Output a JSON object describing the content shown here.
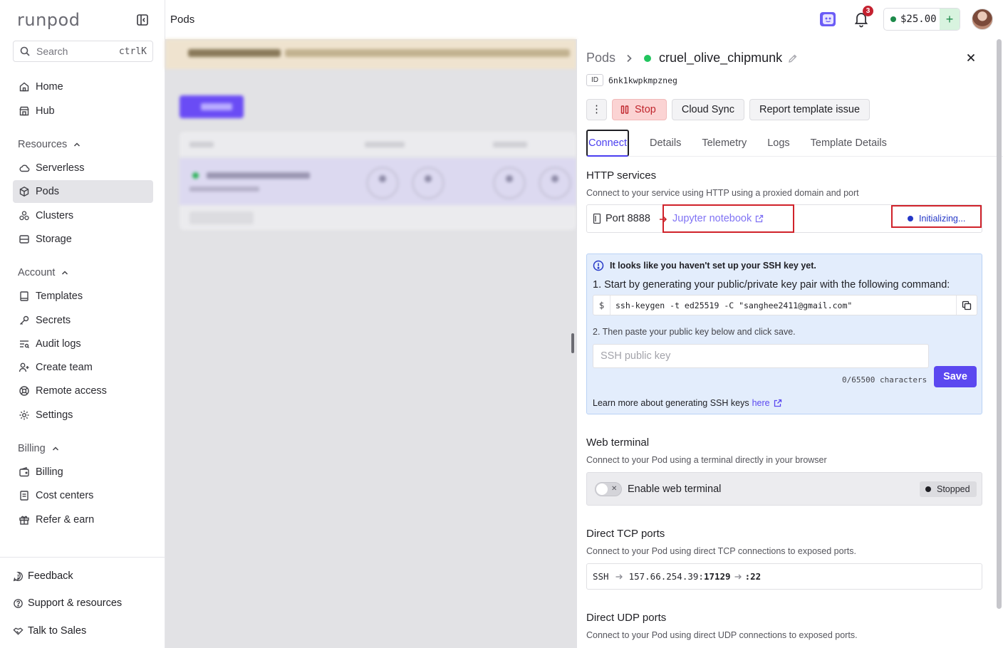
{
  "sidebar": {
    "logo": "runpod",
    "search": {
      "placeholder": "Search",
      "shortcut": "ctrlK"
    },
    "top_items": [
      {
        "label": "Home",
        "icon": "home-icon"
      },
      {
        "label": "Hub",
        "icon": "hub-icon"
      }
    ],
    "sections": [
      {
        "title": "Resources",
        "items": [
          {
            "label": "Serverless",
            "icon": "cloud-icon"
          },
          {
            "label": "Pods",
            "icon": "cube-icon",
            "active": true
          },
          {
            "label": "Clusters",
            "icon": "clusters-icon"
          },
          {
            "label": "Storage",
            "icon": "storage-icon"
          }
        ]
      },
      {
        "title": "Account",
        "items": [
          {
            "label": "Templates",
            "icon": "template-icon"
          },
          {
            "label": "Secrets",
            "icon": "key-icon"
          },
          {
            "label": "Audit logs",
            "icon": "audit-icon"
          },
          {
            "label": "Create team",
            "icon": "user-plus-icon"
          },
          {
            "label": "Remote access",
            "icon": "lifebuoy-icon"
          },
          {
            "label": "Settings",
            "icon": "gear-icon"
          }
        ]
      },
      {
        "title": "Billing",
        "items": [
          {
            "label": "Billing",
            "icon": "wallet-icon"
          },
          {
            "label": "Cost centers",
            "icon": "receipt-icon"
          },
          {
            "label": "Refer & earn",
            "icon": "gift-icon"
          }
        ]
      }
    ],
    "footer": [
      {
        "label": "Feedback",
        "icon": "feedback-icon"
      },
      {
        "label": "Support & resources",
        "icon": "help-icon"
      },
      {
        "label": "Talk to Sales",
        "icon": "handshake-icon"
      }
    ]
  },
  "topbar": {
    "title": "Pods",
    "notifications": "3",
    "balance": "$25.00",
    "balance_add": "+"
  },
  "panel": {
    "breadcrumb_root": "Pods",
    "pod_name": "cruel_olive_chipmunk",
    "id_label": "ID",
    "pod_id": "6nk1kwpkmpzneg",
    "actions": {
      "menu": "⋮",
      "stop": "Stop",
      "cloud_sync": "Cloud Sync",
      "report": "Report template issue"
    },
    "tabs": [
      "Connect",
      "Details",
      "Telemetry",
      "Logs",
      "Template Details"
    ],
    "http": {
      "title": "HTTP services",
      "subtitle": "Connect to your service using HTTP using a proxied domain and port",
      "port": "Port 8888",
      "service": "Jupyter notebook",
      "status": "Initializing..."
    },
    "ssh": {
      "warning": "It looks like you haven't set up your SSH key yet.",
      "step1": "1. Start by generating your public/private key pair with the following command:",
      "prompt": "$",
      "command": "ssh-keygen -t ed25519 -C \"sanghee2411@gmail.com\"",
      "step2": "2. Then paste your public key below and click save.",
      "input_placeholder": "SSH public key",
      "char_count": "0/65500 characters",
      "save": "Save",
      "learn_text": "Learn more about generating SSH keys",
      "learn_link": "here"
    },
    "web_terminal": {
      "title": "Web terminal",
      "subtitle": "Connect to your Pod using a terminal directly in your browser",
      "toggle_label": "Enable web terminal",
      "status": "Stopped"
    },
    "tcp": {
      "title": "Direct TCP ports",
      "subtitle": "Connect to your Pod using direct TCP connections to exposed ports.",
      "proto": "SSH",
      "host": "157.66.254.39:",
      "public_port": "17129",
      "internal_port": ":22"
    },
    "udp": {
      "title": "Direct UDP ports",
      "subtitle": "Connect to your Pod using direct UDP connections to exposed ports."
    }
  },
  "colors": {
    "accent": "#5b48f0",
    "running": "#22c55e",
    "stop_bg": "#fbd3d3",
    "highlight_frame": "#d0222a",
    "info_bg": "#e3edfc"
  }
}
